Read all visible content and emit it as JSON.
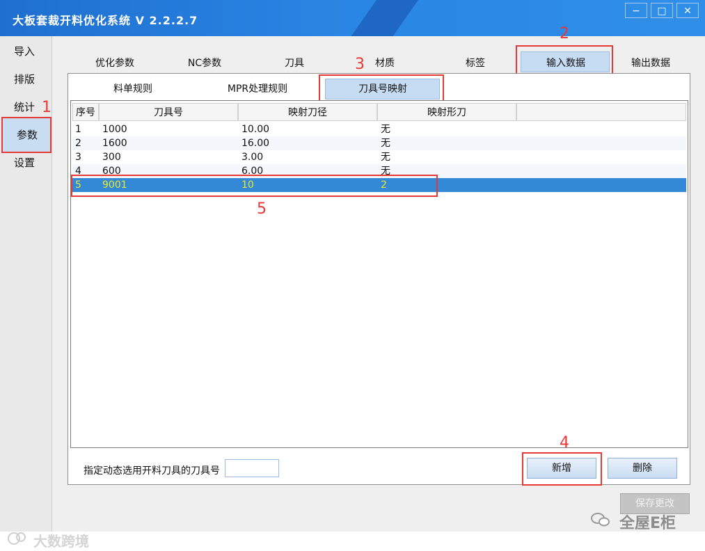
{
  "window": {
    "title": "大板套裁开料优化系统 V 2.2.2.7",
    "min": "−",
    "max": "□",
    "close": "✕"
  },
  "nav": [
    "导入",
    "排版",
    "统计",
    "参数",
    "设置"
  ],
  "top_tabs": [
    "优化参数",
    "NC参数",
    "刀具",
    "材质",
    "标签",
    "输入数据",
    "输出数据"
  ],
  "sub_tabs": [
    "料单规则",
    "MPR处理规则",
    "刀具号映射"
  ],
  "grid": {
    "headers": [
      "序号",
      "刀具号",
      "映射刀径",
      "映射形刀"
    ],
    "rows": [
      [
        "1",
        "1000",
        "10.00",
        "无"
      ],
      [
        "2",
        "1600",
        "16.00",
        "无"
      ],
      [
        "3",
        "300",
        "3.00",
        "无"
      ],
      [
        "4",
        "600",
        "6.00",
        "无"
      ],
      [
        "5",
        "9001",
        "10",
        "2"
      ]
    ]
  },
  "footer": {
    "label": "指定动态选用开料刀具的刀具号",
    "input_value": "",
    "add": "新增",
    "delete": "删除",
    "save": "保存更改"
  },
  "annotations": [
    "1",
    "2",
    "3",
    "4",
    "5"
  ],
  "watermark": {
    "left": "大数跨境",
    "right": "全屋E柜"
  }
}
